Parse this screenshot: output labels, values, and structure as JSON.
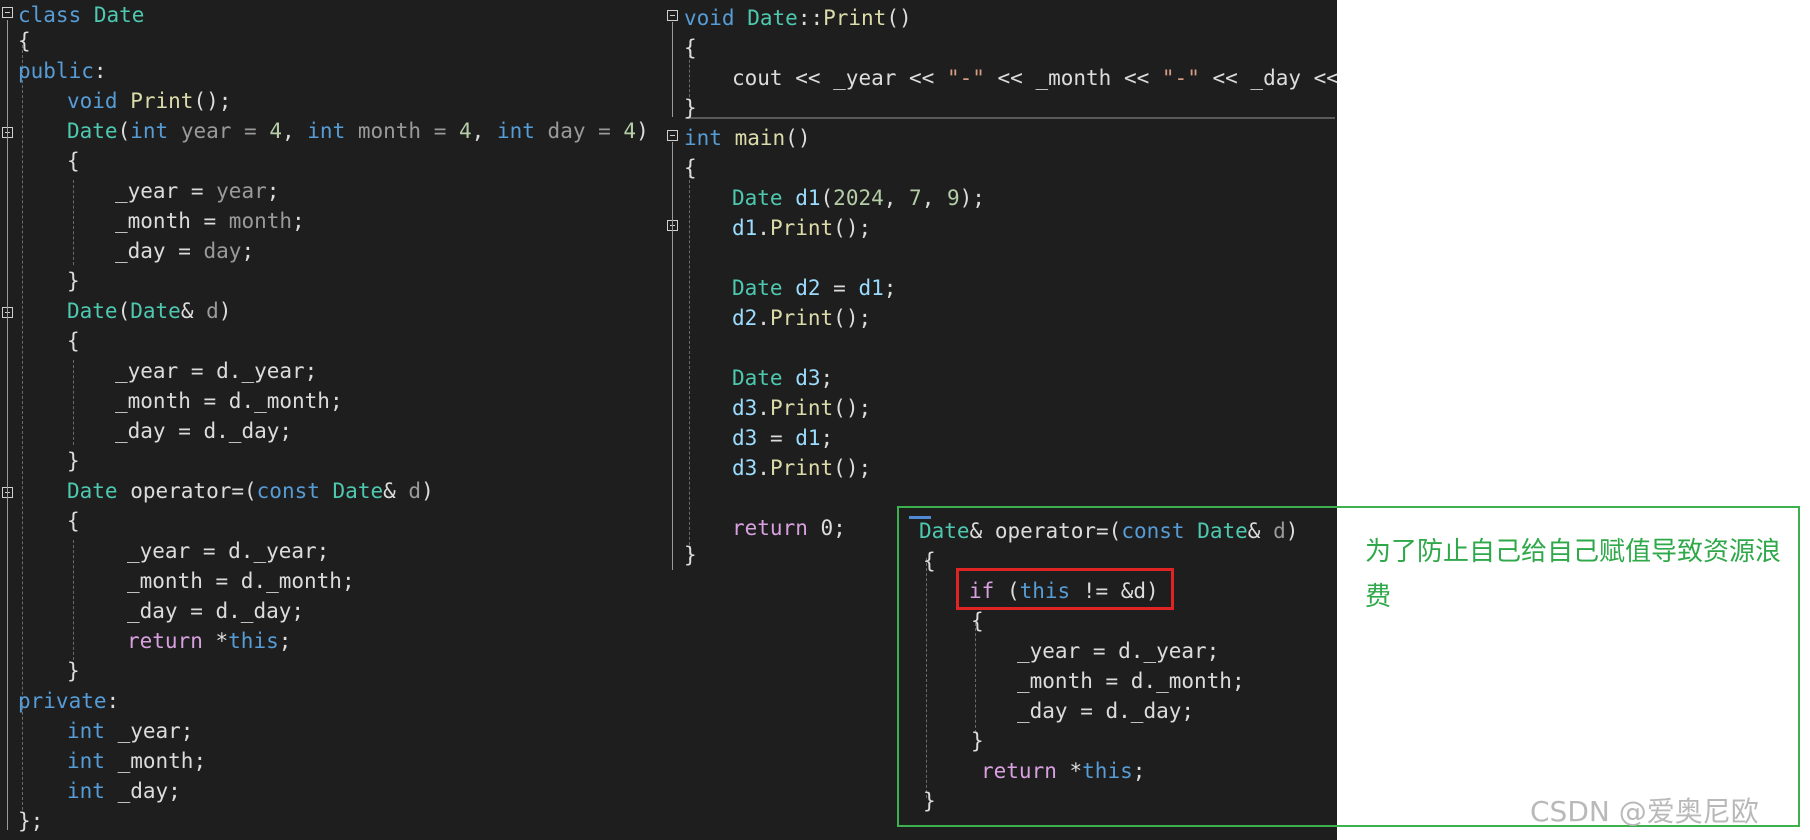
{
  "left_code": {
    "l1_kw": "class",
    "l1_name": "Date",
    "brace_open": "{",
    "public_kw": "public",
    "colon": ":",
    "print_void": "void",
    "print_name": "Print",
    "print_rest": "();",
    "ctor_name": "Date",
    "ctor_paren": "(",
    "ctor_int": "int",
    "ctor_year": " year = ",
    "ctor_num4": "4",
    "ctor_comma": ", ",
    "ctor_month": " month = ",
    "ctor_day": " day = ",
    "ctor_close": ")",
    "year_lhs": "_year",
    "month_lhs": "_month",
    "day_lhs": "_day",
    "eq": " = ",
    "year_rhs": "year",
    "month_rhs": "month",
    "day_rhs": "day",
    "semi": ";",
    "brace_close": "}",
    "copy_name": "Date",
    "copy_paren": "(",
    "copy_type": "Date",
    "copy_ref": "& ",
    "copy_param": "d",
    "copy_close": ")",
    "d_year": "d._year",
    "d_month": "d._month",
    "d_day": "d._day",
    "op_type": "Date",
    "op_name": " operator=(",
    "op_const": "const",
    "op_sp": " ",
    "op_ptype": "Date",
    "op_ref": "& ",
    "op_param": "d",
    "op_close": ")",
    "ret_kw": "return",
    "ret_star": " *",
    "ret_this": "this",
    "private_kw": "private",
    "int_kw": "int",
    "m_year": " _year;",
    "m_month": " _month;",
    "m_day": " _day;",
    "class_close": "};"
  },
  "right_code": {
    "print_void": "void",
    "print_class": "Date",
    "print_scope": "::",
    "print_fn": "Print",
    "print_paren": "()",
    "brace_open": "{",
    "cout": "cout",
    "shl": " << ",
    "year": "_year",
    "str_dash": "\"-\"",
    "month": "_month",
    "day": "_day",
    "trail": " <<",
    "brace_close": "}",
    "main_int": "int",
    "main_fn": "main",
    "main_paren": "()",
    "d1_type": "Date",
    "d1_name": " d1",
    "d1_args_open": "(",
    "n2024": "2024",
    "comma": ", ",
    "n7": "7",
    "n9": "9",
    "args_close": ");",
    "d1_obj": "d1",
    "dot": ".",
    "print_call": "Print",
    "call_end": "();",
    "d2_type": "Date",
    "d2_name": " d2",
    "assign": " = ",
    "d1_ref": "d1",
    "semi": ";",
    "d2_obj": "d2",
    "d3_type": "Date",
    "d3_name": " d3",
    "d3_obj": "d3",
    "ret_kw": "return",
    "zero": " 0",
    "end": ";"
  },
  "callout_code": {
    "op_type": "Date",
    "op_ref": "&",
    "op_name": " operator=(",
    "op_const": "const",
    "op_sp": " ",
    "op_ptype": "Date",
    "op_pref": "& ",
    "op_param": "d",
    "op_close": ")",
    "brace_open": "{",
    "if_kw": "if",
    "if_open": " (",
    "if_this": "this",
    "if_rest": " != &d)",
    "year_lhs": "_year",
    "month_lhs": "_month",
    "day_lhs": "_day",
    "eq": " = ",
    "d_year": "d._year",
    "d_month": "d._month",
    "d_day": "d._day",
    "semi": ";",
    "brace_close": "}",
    "ret_kw": "return",
    "ret_star": " *",
    "ret_this": "this",
    "ret_semi": ";"
  },
  "annotation": {
    "text": "为了防止自己给自己赋值导致资源浪费"
  },
  "watermark": "CSDN @爱奥尼欧",
  "colors": {
    "editor_bg": "#1e1e1e",
    "keyword": "#569cd6",
    "control": "#d8a0df",
    "type": "#4ec9b0",
    "function": "#dcdcaa",
    "variable": "#9cdcfe",
    "number": "#b5cea8",
    "string": "#d69d85",
    "callout_border": "#3cb04d",
    "highlight_border": "#e02424",
    "annotation_text": "#2fa84a"
  },
  "icons": [
    "fold-toggle-icon"
  ]
}
